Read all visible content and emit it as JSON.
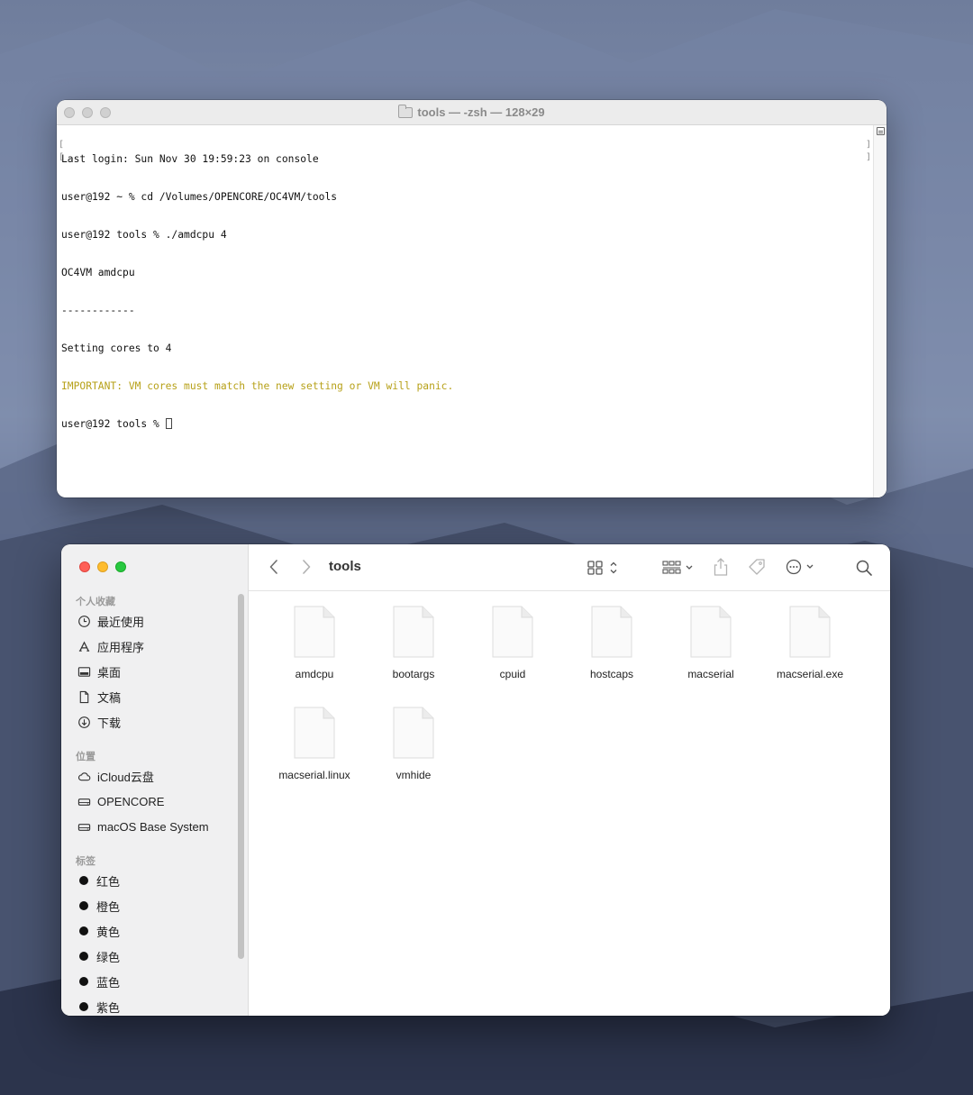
{
  "terminal": {
    "title": "tools — -zsh — 128×29",
    "lines": [
      "Last login: Sun Nov 30 19:59:23 on console",
      "user@192 ~ % cd /Volumes/OPENCORE/OC4VM/tools",
      "user@192 tools % ./amdcpu 4",
      "OC4VM amdcpu",
      "------------",
      "Setting cores to 4",
      "IMPORTANT: VM cores must match the new setting or VM will panic.",
      "user@192 tools % "
    ],
    "warning_color": "#b7a119"
  },
  "finder": {
    "path_title": "tools",
    "sidebar": {
      "favorites_header": "个人收藏",
      "favorites": [
        {
          "label": "最近使用",
          "icon": "clock-icon"
        },
        {
          "label": "应用程序",
          "icon": "applications-icon"
        },
        {
          "label": "桌面",
          "icon": "desktop-icon"
        },
        {
          "label": "文稿",
          "icon": "document-icon"
        },
        {
          "label": "下载",
          "icon": "download-icon"
        }
      ],
      "locations_header": "位置",
      "locations": [
        {
          "label": "iCloud云盘",
          "icon": "cloud-icon"
        },
        {
          "label": "OPENCORE",
          "icon": "drive-icon"
        },
        {
          "label": "macOS Base System",
          "icon": "drive-icon"
        }
      ],
      "tags_header": "标签",
      "tags": [
        {
          "label": "红色"
        },
        {
          "label": "橙色"
        },
        {
          "label": "黄色"
        },
        {
          "label": "绿色"
        },
        {
          "label": "蓝色"
        },
        {
          "label": "紫色"
        }
      ]
    },
    "files": [
      {
        "name": "amdcpu"
      },
      {
        "name": "bootargs"
      },
      {
        "name": "cpuid"
      },
      {
        "name": "hostcaps"
      },
      {
        "name": "macserial"
      },
      {
        "name": "macserial.exe"
      },
      {
        "name": "macserial.linux"
      },
      {
        "name": "vmhide"
      }
    ]
  }
}
